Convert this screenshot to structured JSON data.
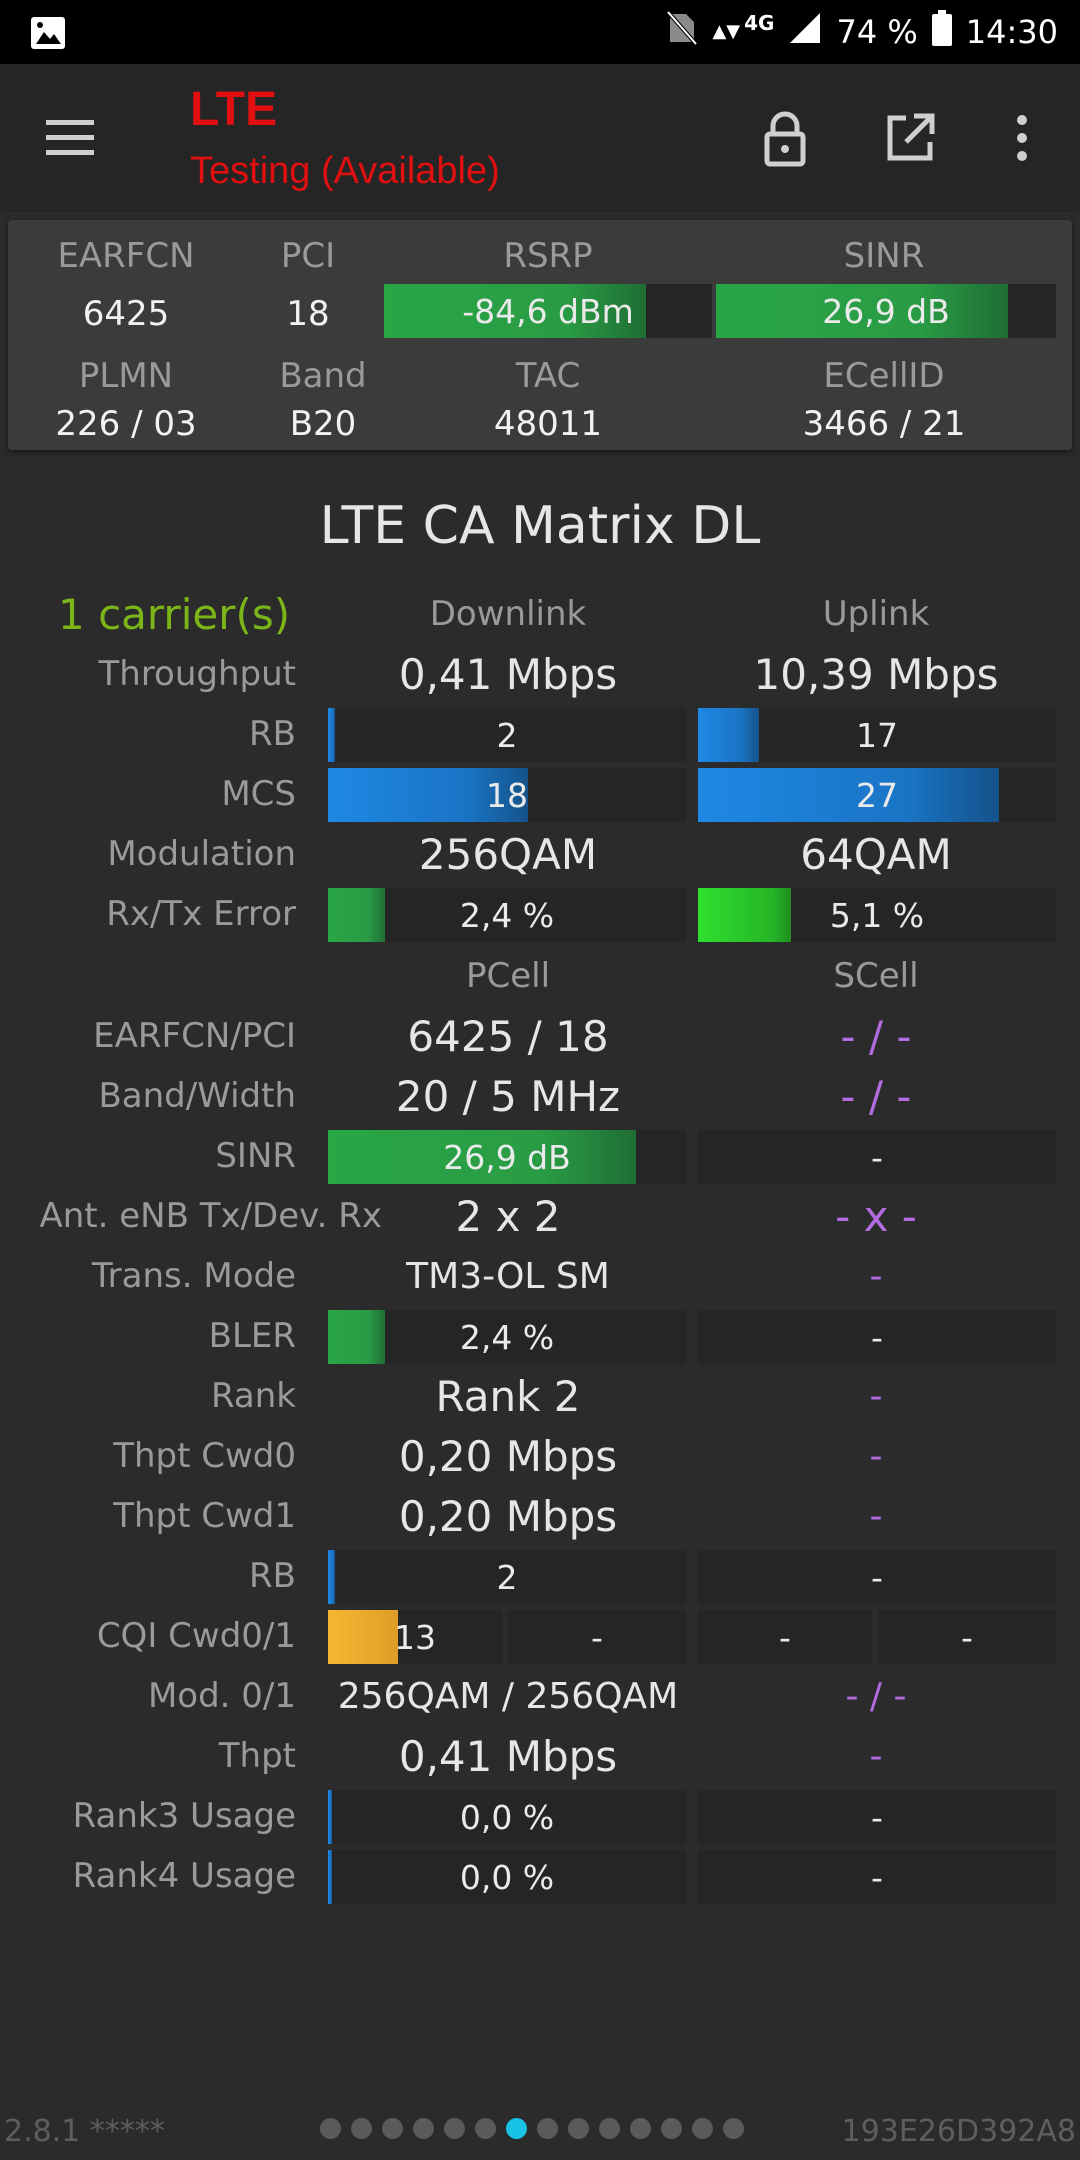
{
  "status_bar": {
    "signal_type": "4G",
    "battery": "74 %",
    "time": "14:30"
  },
  "app_bar": {
    "title": "LTE",
    "subtitle": "Testing (Available)"
  },
  "info": {
    "labels": {
      "earfcn": "EARFCN",
      "pci": "PCI",
      "rsrp": "RSRP",
      "sinr": "SINR",
      "plmn": "PLMN",
      "band": "Band",
      "tac": "TAC",
      "ecellid": "ECellID"
    },
    "earfcn": "6425",
    "pci": "18",
    "rsrp": "-84,6 dBm",
    "rsrp_level": 0.8,
    "sinr": "26,9 dB",
    "sinr_level": 0.86,
    "plmn": "226 / 03",
    "band": "B20",
    "tac": "48011",
    "ecellid": "3466 / 21"
  },
  "matrix": {
    "title": "LTE CA Matrix DL",
    "carriers": "1 carrier(s)",
    "col_downlink": "Downlink",
    "col_uplink": "Uplink",
    "col_pcell": "PCell",
    "col_scell": "SCell",
    "labels": {
      "throughput": "Throughput",
      "rb": "RB",
      "mcs": "MCS",
      "modulation": "Modulation",
      "rxtx_error": "Rx/Tx Error",
      "earfcn_pci": "EARFCN/PCI",
      "band_width": "Band/Width",
      "sinr": "SINR",
      "ant": "Ant. eNB Tx/Dev. Rx",
      "trans_mode": "Trans. Mode",
      "bler": "BLER",
      "rank": "Rank",
      "thpt_cwd0": "Thpt Cwd0",
      "thpt_cwd1": "Thpt Cwd1",
      "rb2": "RB",
      "cqi": "CQI Cwd0/1",
      "mod01": "Mod. 0/1",
      "thpt": "Thpt",
      "rank3": "Rank3 Usage",
      "rank4": "Rank4 Usage"
    },
    "downlink": {
      "throughput": "0,41 Mbps",
      "rb": "2",
      "rb_level": 0.02,
      "mcs": "18",
      "mcs_level": 0.56,
      "modulation": "256QAM",
      "error": "2,4 %",
      "error_level": 0.16
    },
    "uplink": {
      "throughput": "10,39 Mbps",
      "rb": "17",
      "rb_level": 0.17,
      "mcs": "27",
      "mcs_level": 0.84,
      "modulation": "64QAM",
      "error": "5,1 %",
      "error_level": 0.26
    },
    "pcell": {
      "earfcn_pci": "6425 / 18",
      "band_width": "20 / 5 MHz",
      "sinr": "26,9 dB",
      "sinr_level": 0.86,
      "ant": "2 x 2",
      "trans_mode": "TM3-OL SM",
      "bler": "2,4 %",
      "bler_level": 0.16,
      "rank": "Rank 2",
      "thpt_cwd0": "0,20 Mbps",
      "thpt_cwd1": "0,20 Mbps",
      "rb": "2",
      "rb_level": 0.02,
      "cqi0": "13",
      "cqi0_level": 0.4,
      "cqi1": "-",
      "mod01": "256QAM / 256QAM",
      "thpt": "0,41 Mbps",
      "rank3": "0,0 %",
      "rank3_level": 0.01,
      "rank4": "0,0 %",
      "rank4_level": 0.01
    },
    "scell": {
      "earfcn_pci": "- / -",
      "band_width": "- / -",
      "sinr": "-",
      "ant": "- x -",
      "trans_mode": "-",
      "bler": "-",
      "rank": "-",
      "thpt_cwd0": "-",
      "thpt_cwd1": "-",
      "rb": "-",
      "cqi0": "-",
      "cqi1": "-",
      "mod01": "- / -",
      "thpt": "-",
      "rank3": "-",
      "rank4": "-"
    }
  },
  "footer": {
    "version": "2.8.1 *****",
    "device_id": "193E26D392A8",
    "page_count": 14,
    "active_page": 6
  },
  "colors": {
    "accent_red": "#e01010",
    "carrier_green": "#7cb518",
    "scell_purple": "#b36be0",
    "active_dot": "#19c3e6"
  }
}
